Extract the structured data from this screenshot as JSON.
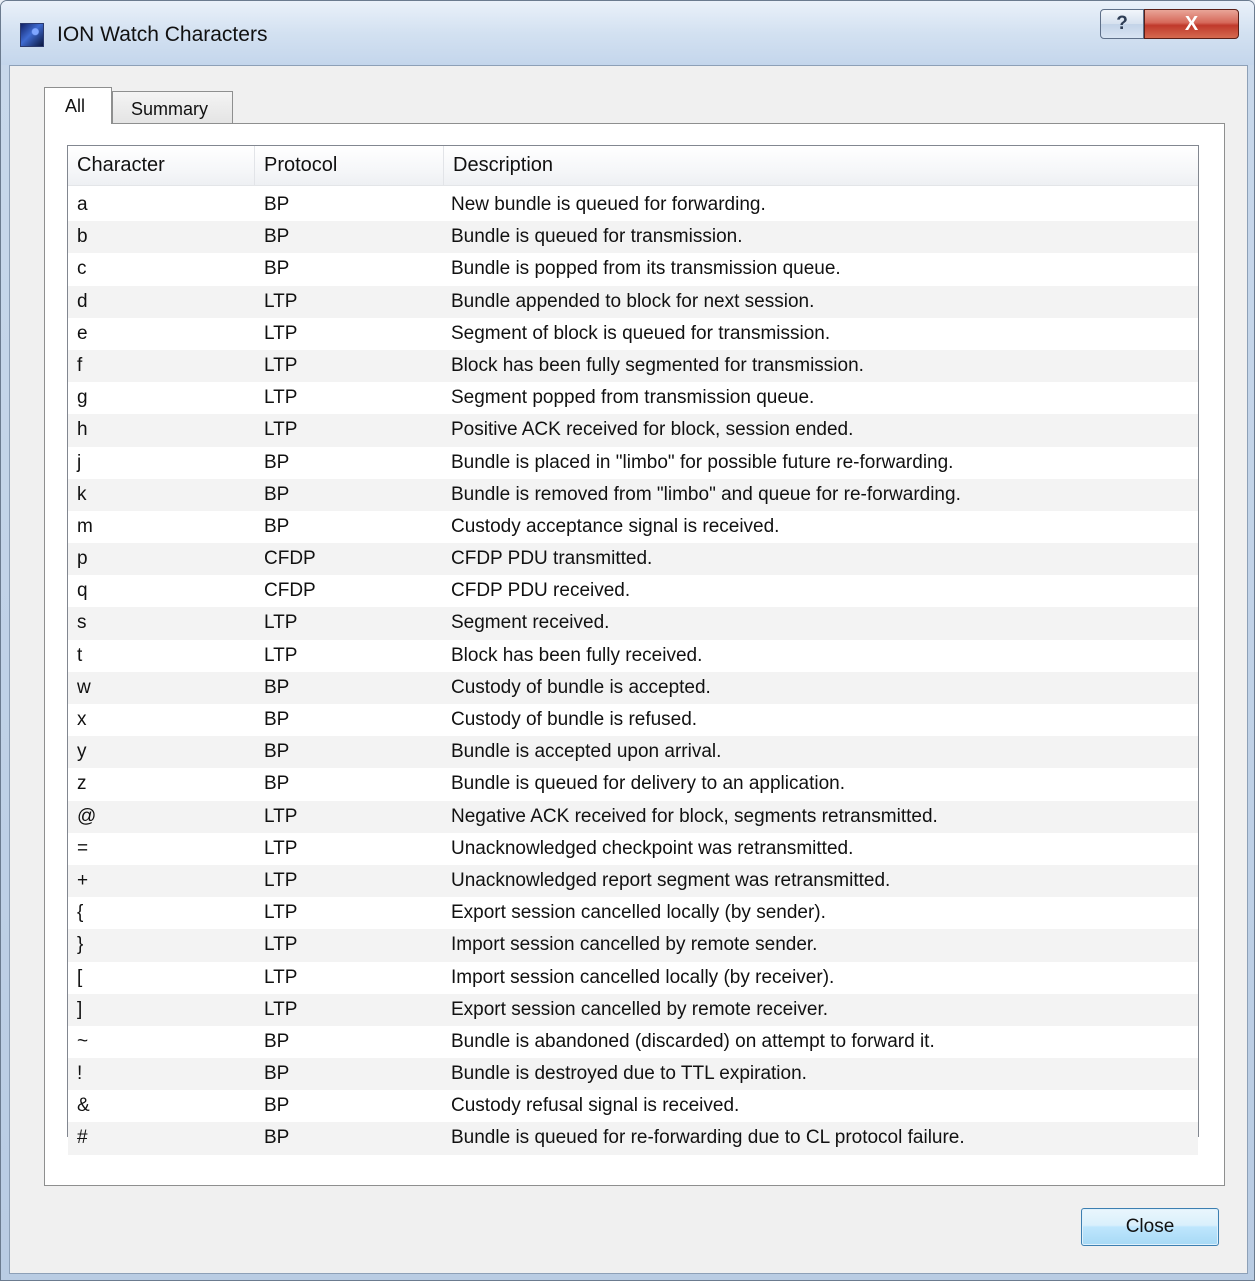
{
  "window": {
    "title": "ION Watch Characters",
    "help_glyph": "?",
    "close_glyph": "X"
  },
  "tabs": [
    {
      "label": "All",
      "selected": true
    },
    {
      "label": "Summary",
      "selected": false
    }
  ],
  "table": {
    "columns": [
      "Character",
      "Protocol",
      "Description"
    ],
    "rows": [
      {
        "character": "a",
        "protocol": "BP",
        "description": "New bundle is queued for forwarding."
      },
      {
        "character": "b",
        "protocol": "BP",
        "description": "Bundle is queued for transmission."
      },
      {
        "character": "c",
        "protocol": "BP",
        "description": "Bundle is popped from its transmission queue."
      },
      {
        "character": "d",
        "protocol": "LTP",
        "description": "Bundle appended to block for next session."
      },
      {
        "character": "e",
        "protocol": "LTP",
        "description": "Segment of block is queued for transmission."
      },
      {
        "character": "f",
        "protocol": "LTP",
        "description": "Block has been fully segmented for transmission."
      },
      {
        "character": "g",
        "protocol": "LTP",
        "description": "Segment popped from transmission queue."
      },
      {
        "character": "h",
        "protocol": "LTP",
        "description": "Positive ACK received for block, session ended."
      },
      {
        "character": "j",
        "protocol": "BP",
        "description": "Bundle is placed in \"limbo\" for possible future re-forwarding."
      },
      {
        "character": "k",
        "protocol": "BP",
        "description": "Bundle is removed from \"limbo\" and queue for re-forwarding."
      },
      {
        "character": "m",
        "protocol": "BP",
        "description": "Custody acceptance signal is received."
      },
      {
        "character": "p",
        "protocol": "CFDP",
        "description": "CFDP PDU transmitted."
      },
      {
        "character": "q",
        "protocol": "CFDP",
        "description": "CFDP PDU received."
      },
      {
        "character": "s",
        "protocol": "LTP",
        "description": "Segment received."
      },
      {
        "character": "t",
        "protocol": "LTP",
        "description": "Block has been fully received."
      },
      {
        "character": "w",
        "protocol": "BP",
        "description": "Custody of bundle is accepted."
      },
      {
        "character": "x",
        "protocol": "BP",
        "description": "Custody of bundle is refused."
      },
      {
        "character": "y",
        "protocol": "BP",
        "description": "Bundle is accepted upon arrival."
      },
      {
        "character": "z",
        "protocol": "BP",
        "description": "Bundle is queued for delivery to an application."
      },
      {
        "character": "@",
        "protocol": "LTP",
        "description": "Negative ACK received for block, segments retransmitted."
      },
      {
        "character": "=",
        "protocol": "LTP",
        "description": "Unacknowledged checkpoint was retransmitted."
      },
      {
        "character": "+",
        "protocol": "LTP",
        "description": "Unacknowledged report segment was retransmitted."
      },
      {
        "character": "{",
        "protocol": "LTP",
        "description": "Export session cancelled locally (by sender)."
      },
      {
        "character": "}",
        "protocol": "LTP",
        "description": "Import session cancelled by remote sender."
      },
      {
        "character": "[",
        "protocol": "LTP",
        "description": "Import session cancelled locally (by receiver)."
      },
      {
        "character": "]",
        "protocol": "LTP",
        "description": "Export session cancelled by remote receiver."
      },
      {
        "character": "~",
        "protocol": "BP",
        "description": "Bundle is abandoned (discarded) on attempt to forward it."
      },
      {
        "character": "!",
        "protocol": "BP",
        "description": "Bundle is destroyed due to TTL expiration."
      },
      {
        "character": "&",
        "protocol": "BP",
        "description": "Custody refusal signal is received."
      },
      {
        "character": "#",
        "protocol": "BP",
        "description": "Bundle is queued for re-forwarding due to CL protocol failure."
      }
    ]
  },
  "footer": {
    "close_label": "Close"
  }
}
